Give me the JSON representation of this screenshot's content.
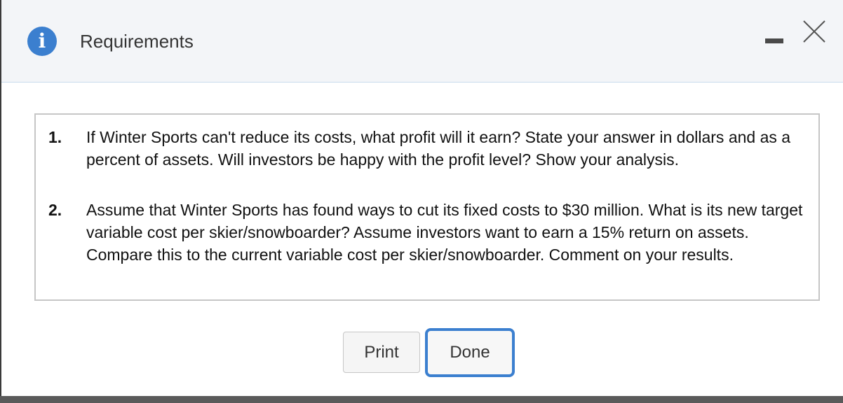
{
  "dialog": {
    "title": "Requirements",
    "icons": {
      "info": "info-icon",
      "minimize": "minimize-icon",
      "close": "close-icon"
    },
    "info_glyph": "i"
  },
  "requirements": [
    {
      "number": "1.",
      "text": "If Winter Sports can't reduce its costs, what profit will it earn? State your answer in dollars and as a percent of assets. Will investors be happy with the profit level? Show your analysis."
    },
    {
      "number": "2.",
      "text": "Assume that Winter Sports has found ways to cut its fixed costs to $30 million. What is its new target variable cost per skier/snowboarder? Assume investors want to earn a 15% return on assets. Compare this to the current variable cost per skier/snowboarder. Comment on your results."
    }
  ],
  "buttons": {
    "print_label": "Print",
    "done_label": "Done"
  },
  "colors": {
    "accent": "#3b7fcf",
    "titlebar_bg": "#f3f5f8"
  }
}
